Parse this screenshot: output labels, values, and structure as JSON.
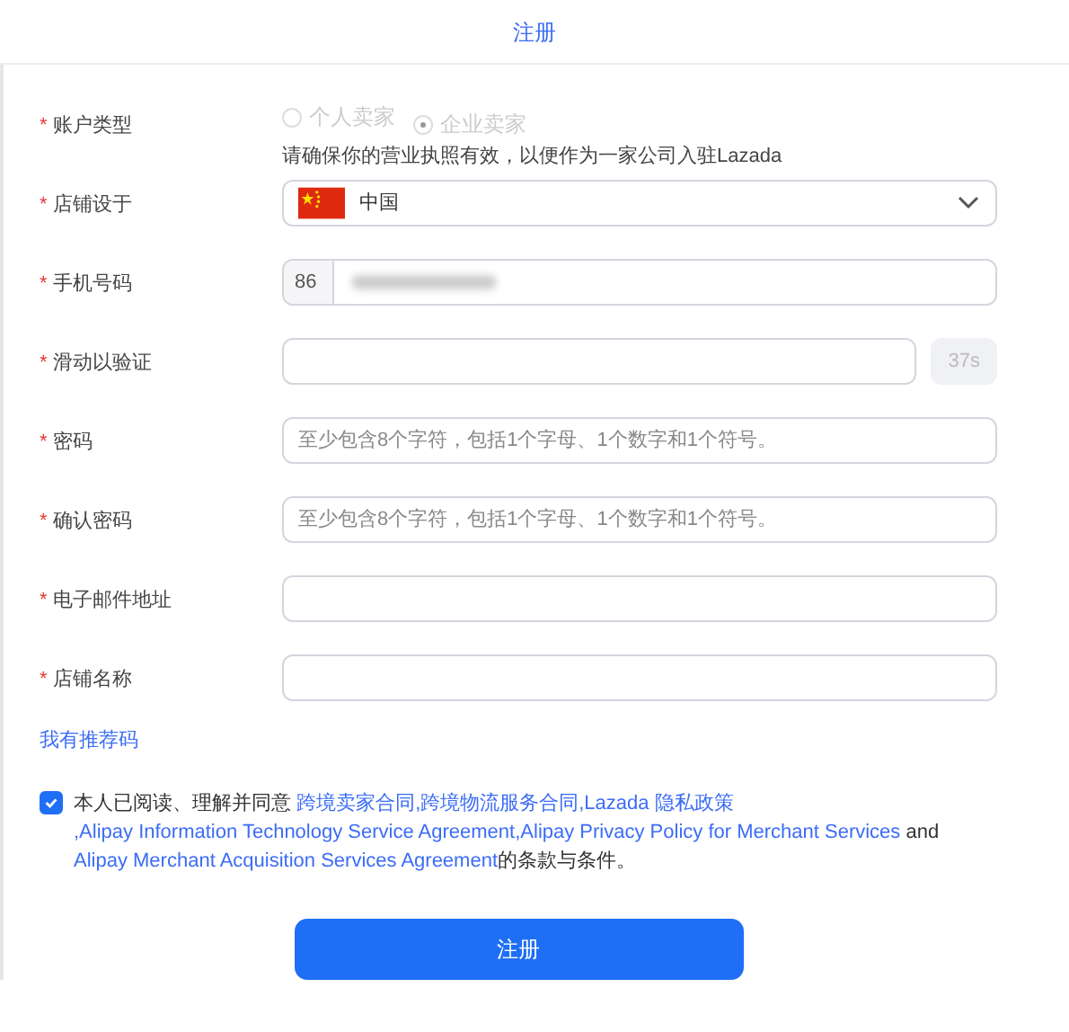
{
  "header": {
    "title": "注册"
  },
  "fields": [
    {
      "kind": "radio",
      "label": "账户类型",
      "required": true,
      "options": [
        {
          "label": "个人卖家",
          "selected": false,
          "disabled": true
        },
        {
          "label": "企业卖家",
          "selected": true,
          "disabled": true
        }
      ],
      "hint": "请确保你的营业执照有效，以便作为一家公司入驻Lazada"
    },
    {
      "kind": "select",
      "label": "店铺设于",
      "required": true,
      "value": "中国"
    },
    {
      "kind": "phone",
      "label": "手机号码",
      "required": true,
      "prefix": "86"
    },
    {
      "kind": "verify",
      "label": "滑动以验证",
      "required": true,
      "timer": "37s",
      "timer_disabled": true
    },
    {
      "kind": "input",
      "label": "密码",
      "required": true,
      "placeholder": "至少包含8个字符，包括1个字母、1个数字和1个符号。"
    },
    {
      "kind": "input",
      "label": "确认密码",
      "required": true,
      "placeholder": "至少包含8个字符，包括1个字母、1个数字和1个符号。"
    },
    {
      "kind": "input",
      "label": "电子邮件地址",
      "required": true
    },
    {
      "kind": "input",
      "label": "店铺名称",
      "required": true
    }
  ],
  "required_mark": "*",
  "referral_link": "我有推荐码",
  "agreement": {
    "checked": true,
    "parts": [
      {
        "kind": "text",
        "text": "本人已阅读、理解并同意 "
      },
      {
        "kind": "link",
        "text": "跨境卖家合同"
      },
      {
        "kind": "link",
        "text": ",跨境物流服务合同"
      },
      {
        "kind": "link",
        "text": ",Lazada 隐私政策"
      },
      {
        "kind": "link",
        "text": ",Alipay Information Technology Service Agreement"
      },
      {
        "kind": "link",
        "text": ",Alipay Privacy Policy for Merchant Services"
      },
      {
        "kind": "text",
        "text": " and "
      },
      {
        "kind": "link",
        "text": "Alipay Merchant Acquisition Services Agreement"
      },
      {
        "kind": "text",
        "text": "的条款与条件。"
      }
    ]
  },
  "submit_button": "注册"
}
